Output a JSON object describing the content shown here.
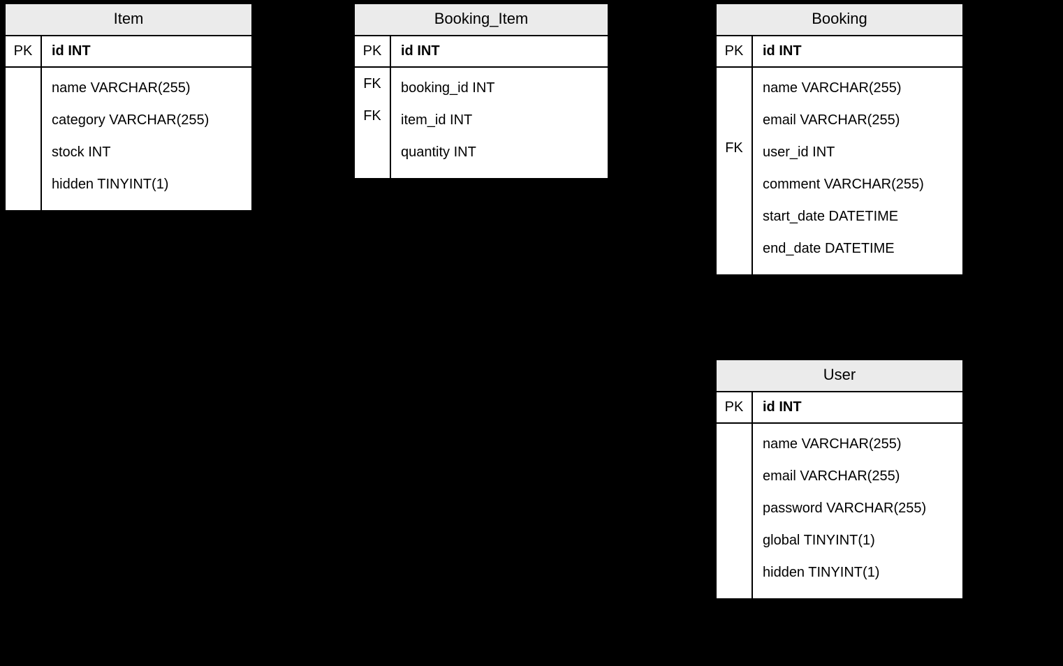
{
  "entities": {
    "item": {
      "title": "Item",
      "pk_label": "PK",
      "pk_field": "id INT",
      "attrs": [
        {
          "key": "",
          "field": "name VARCHAR(255)"
        },
        {
          "key": "",
          "field": "category VARCHAR(255)"
        },
        {
          "key": "",
          "field": "stock INT"
        },
        {
          "key": "",
          "field": "hidden TINYINT(1)"
        }
      ]
    },
    "booking_item": {
      "title": "Booking_Item",
      "pk_label": "PK",
      "pk_field": "id INT",
      "attrs": [
        {
          "key": "FK",
          "field": "booking_id INT"
        },
        {
          "key": "FK",
          "field": "item_id INT"
        },
        {
          "key": "",
          "field": "quantity INT"
        }
      ]
    },
    "booking": {
      "title": "Booking",
      "pk_label": "PK",
      "pk_field": "id INT",
      "attrs": [
        {
          "key": "",
          "field": "name VARCHAR(255)"
        },
        {
          "key": "",
          "field": "email VARCHAR(255)"
        },
        {
          "key": "FK",
          "field": "user_id INT"
        },
        {
          "key": "",
          "field": "comment VARCHAR(255)"
        },
        {
          "key": "",
          "field": "start_date DATETIME"
        },
        {
          "key": "",
          "field": "end_date DATETIME"
        }
      ]
    },
    "user": {
      "title": "User",
      "pk_label": "PK",
      "pk_field": "id INT",
      "attrs": [
        {
          "key": "",
          "field": "name VARCHAR(255)"
        },
        {
          "key": "",
          "field": "email VARCHAR(255)"
        },
        {
          "key": "",
          "field": "password VARCHAR(255)"
        },
        {
          "key": "",
          "field": "global TINYINT(1)"
        },
        {
          "key": "",
          "field": "hidden TINYINT(1)"
        }
      ]
    }
  }
}
